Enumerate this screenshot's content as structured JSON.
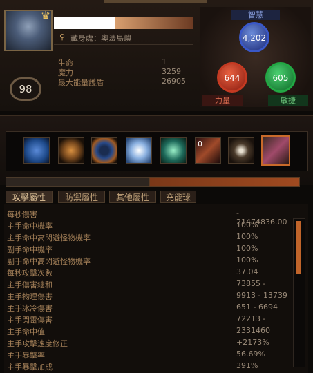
{
  "character": {
    "level": "98",
    "hideout": "藏身處：奧法島嶼"
  },
  "core_stats": [
    {
      "label": "生命",
      "value": "1"
    },
    {
      "label": "魔力",
      "value": "3259"
    },
    {
      "label": "最大能量護盾",
      "value": "26905"
    }
  ],
  "attributes": {
    "intelligence_label": "智慧",
    "intelligence_value": "4,202",
    "strength_label": "力量",
    "strength_value": "644",
    "dexterity_label": "敏捷",
    "dexterity_value": "605"
  },
  "gems": [
    {
      "icon": "blue-vortex-icon",
      "color": "#1e4a8a"
    },
    {
      "icon": "orange-ring-icon",
      "color": "#7a4a1e"
    },
    {
      "icon": "blue-orb-icon",
      "color": "#284a8a"
    },
    {
      "icon": "white-burst-icon",
      "color": "#5a7aa8"
    },
    {
      "icon": "green-swirl-icon",
      "color": "#1e6a5a"
    },
    {
      "icon": "dagger-icon",
      "color": "#5a2a2a",
      "count": "0"
    },
    {
      "icon": "eye-icon",
      "color": "#4a3a2a"
    },
    {
      "icon": "sword-icon",
      "color": "#3a2a22"
    }
  ],
  "tabs": [
    "攻擊屬性",
    "防禦屬性",
    "其他屬性",
    "充能球"
  ],
  "stats": [
    {
      "label": "每秒傷害",
      "value": "- 21474836.00"
    },
    {
      "label": "主手命中機率",
      "value": "100%"
    },
    {
      "label": "主手命中高閃避怪物機率",
      "value": "100%"
    },
    {
      "label": "副手命中機率",
      "value": "100%"
    },
    {
      "label": "副手命中高閃避怪物機率",
      "value": "100%"
    },
    {
      "label": "每秒攻擊次數",
      "value": "37.04"
    },
    {
      "label": "主手傷害總和",
      "value": "73855 -"
    },
    {
      "label": "主手物理傷害",
      "value": "9913 - 13739"
    },
    {
      "label": "主手冰冷傷害",
      "value": "651 - 6694"
    },
    {
      "label": "主手閃電傷害",
      "value": "72213 -"
    },
    {
      "label": "主手命中值",
      "value": "2331460"
    },
    {
      "label": "主手攻擊速度修正",
      "value": "+2173%"
    },
    {
      "label": "主手暴擊率",
      "value": "56.69%"
    },
    {
      "label": "主手暴擊加成",
      "value": "391%"
    }
  ]
}
